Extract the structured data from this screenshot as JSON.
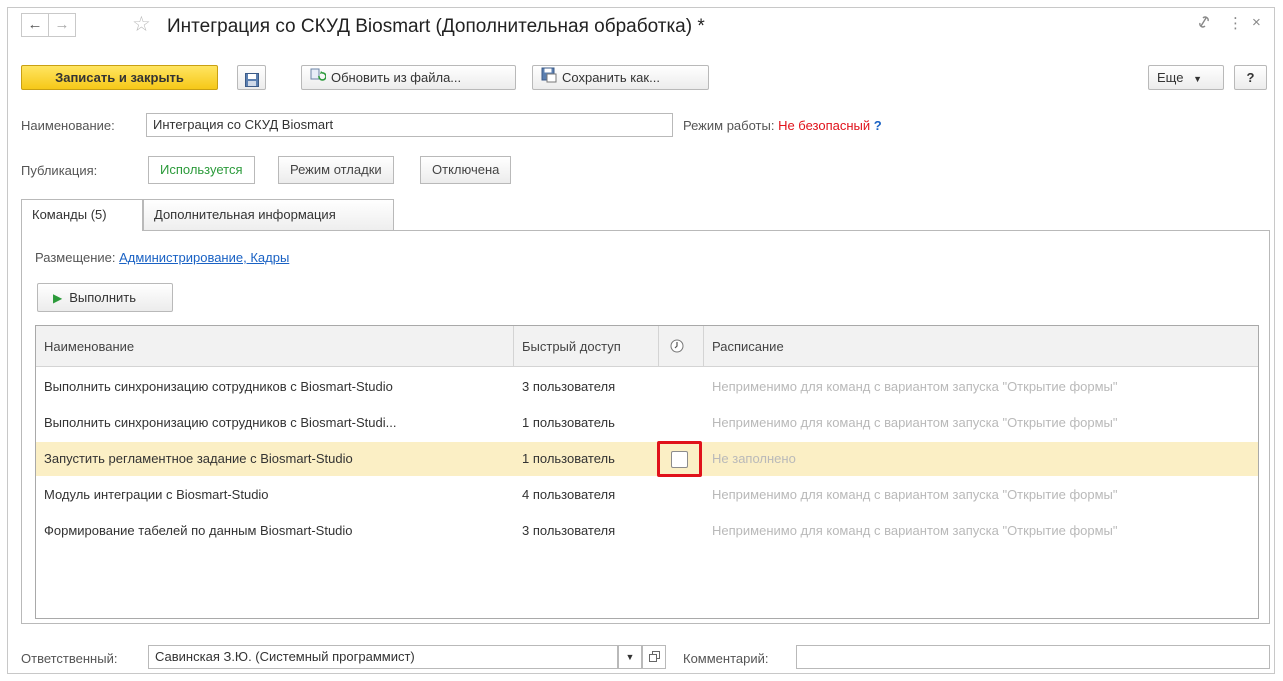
{
  "window": {
    "title": "Интеграция со СКУД Biosmart (Дополнительная обработка) *",
    "back_icon": "←",
    "forward_icon": "→",
    "star_icon": "☆",
    "link_icon": "🔗",
    "more_icon": "⋮",
    "close_icon": "×"
  },
  "toolbar": {
    "save_close_label": "Записать и закрыть",
    "update_from_file_label": "Обновить из файла...",
    "save_as_label": "Сохранить как...",
    "more_label": "Еще",
    "help_label": "?"
  },
  "form": {
    "name_label": "Наименование:",
    "name_value": "Интеграция со СКУД Biosmart",
    "mode_label": "Режим работы:",
    "mode_value": "Не безопасный",
    "mode_help": "?",
    "publication_label": "Публикация:",
    "publication_options": [
      "Используется",
      "Режим отладки",
      "Отключена"
    ],
    "publication_selected": "Используется"
  },
  "tabs": [
    {
      "label": "Команды (5)"
    },
    {
      "label": "Дополнительная информация"
    }
  ],
  "commands": {
    "placement_label": "Размещение:",
    "placement_value": "Администрирование, Кадры",
    "run_label": "Выполнить",
    "columns": [
      "Наименование",
      "Быстрый доступ",
      "",
      "Расписание"
    ],
    "rows": [
      {
        "name": "Выполнить синхронизацию сотрудников с Biosmart-Studio",
        "access": "3 пользователя",
        "schedule": "Неприменимо для команд с вариантом запуска \"Открытие формы\""
      },
      {
        "name": "Выполнить синхронизацию сотрудников с Biosmart-Studi...",
        "access": "1 пользователь",
        "schedule": "Неприменимо для команд с вариантом запуска \"Открытие формы\""
      },
      {
        "name": "Запустить регламентное задание с Biosmart-Studio",
        "access": "1 пользователь",
        "schedule": "Не заполнено",
        "selected": true,
        "checked": false
      },
      {
        "name": "Модуль интеграции с Biosmart-Studio",
        "access": "4 пользователя",
        "schedule": "Неприменимо для команд с вариантом запуска \"Открытие формы\""
      },
      {
        "name": "Формирование табелей по данным Biosmart-Studio",
        "access": "3 пользователя",
        "schedule": "Неприменимо для команд с вариантом запуска \"Открытие формы\""
      }
    ]
  },
  "footer": {
    "responsible_label": "Ответственный:",
    "responsible_value": "Савинская З.Ю. (Системный программист)",
    "comment_label": "Комментарий:",
    "comment_value": ""
  },
  "colors": {
    "accent_yellow": "#f6c818",
    "selected_row": "#fbefc5",
    "highlight_red": "#e0121b",
    "link_blue": "#1a62c4",
    "active_green": "#2b9a3a",
    "danger_red": "#e0121b"
  }
}
